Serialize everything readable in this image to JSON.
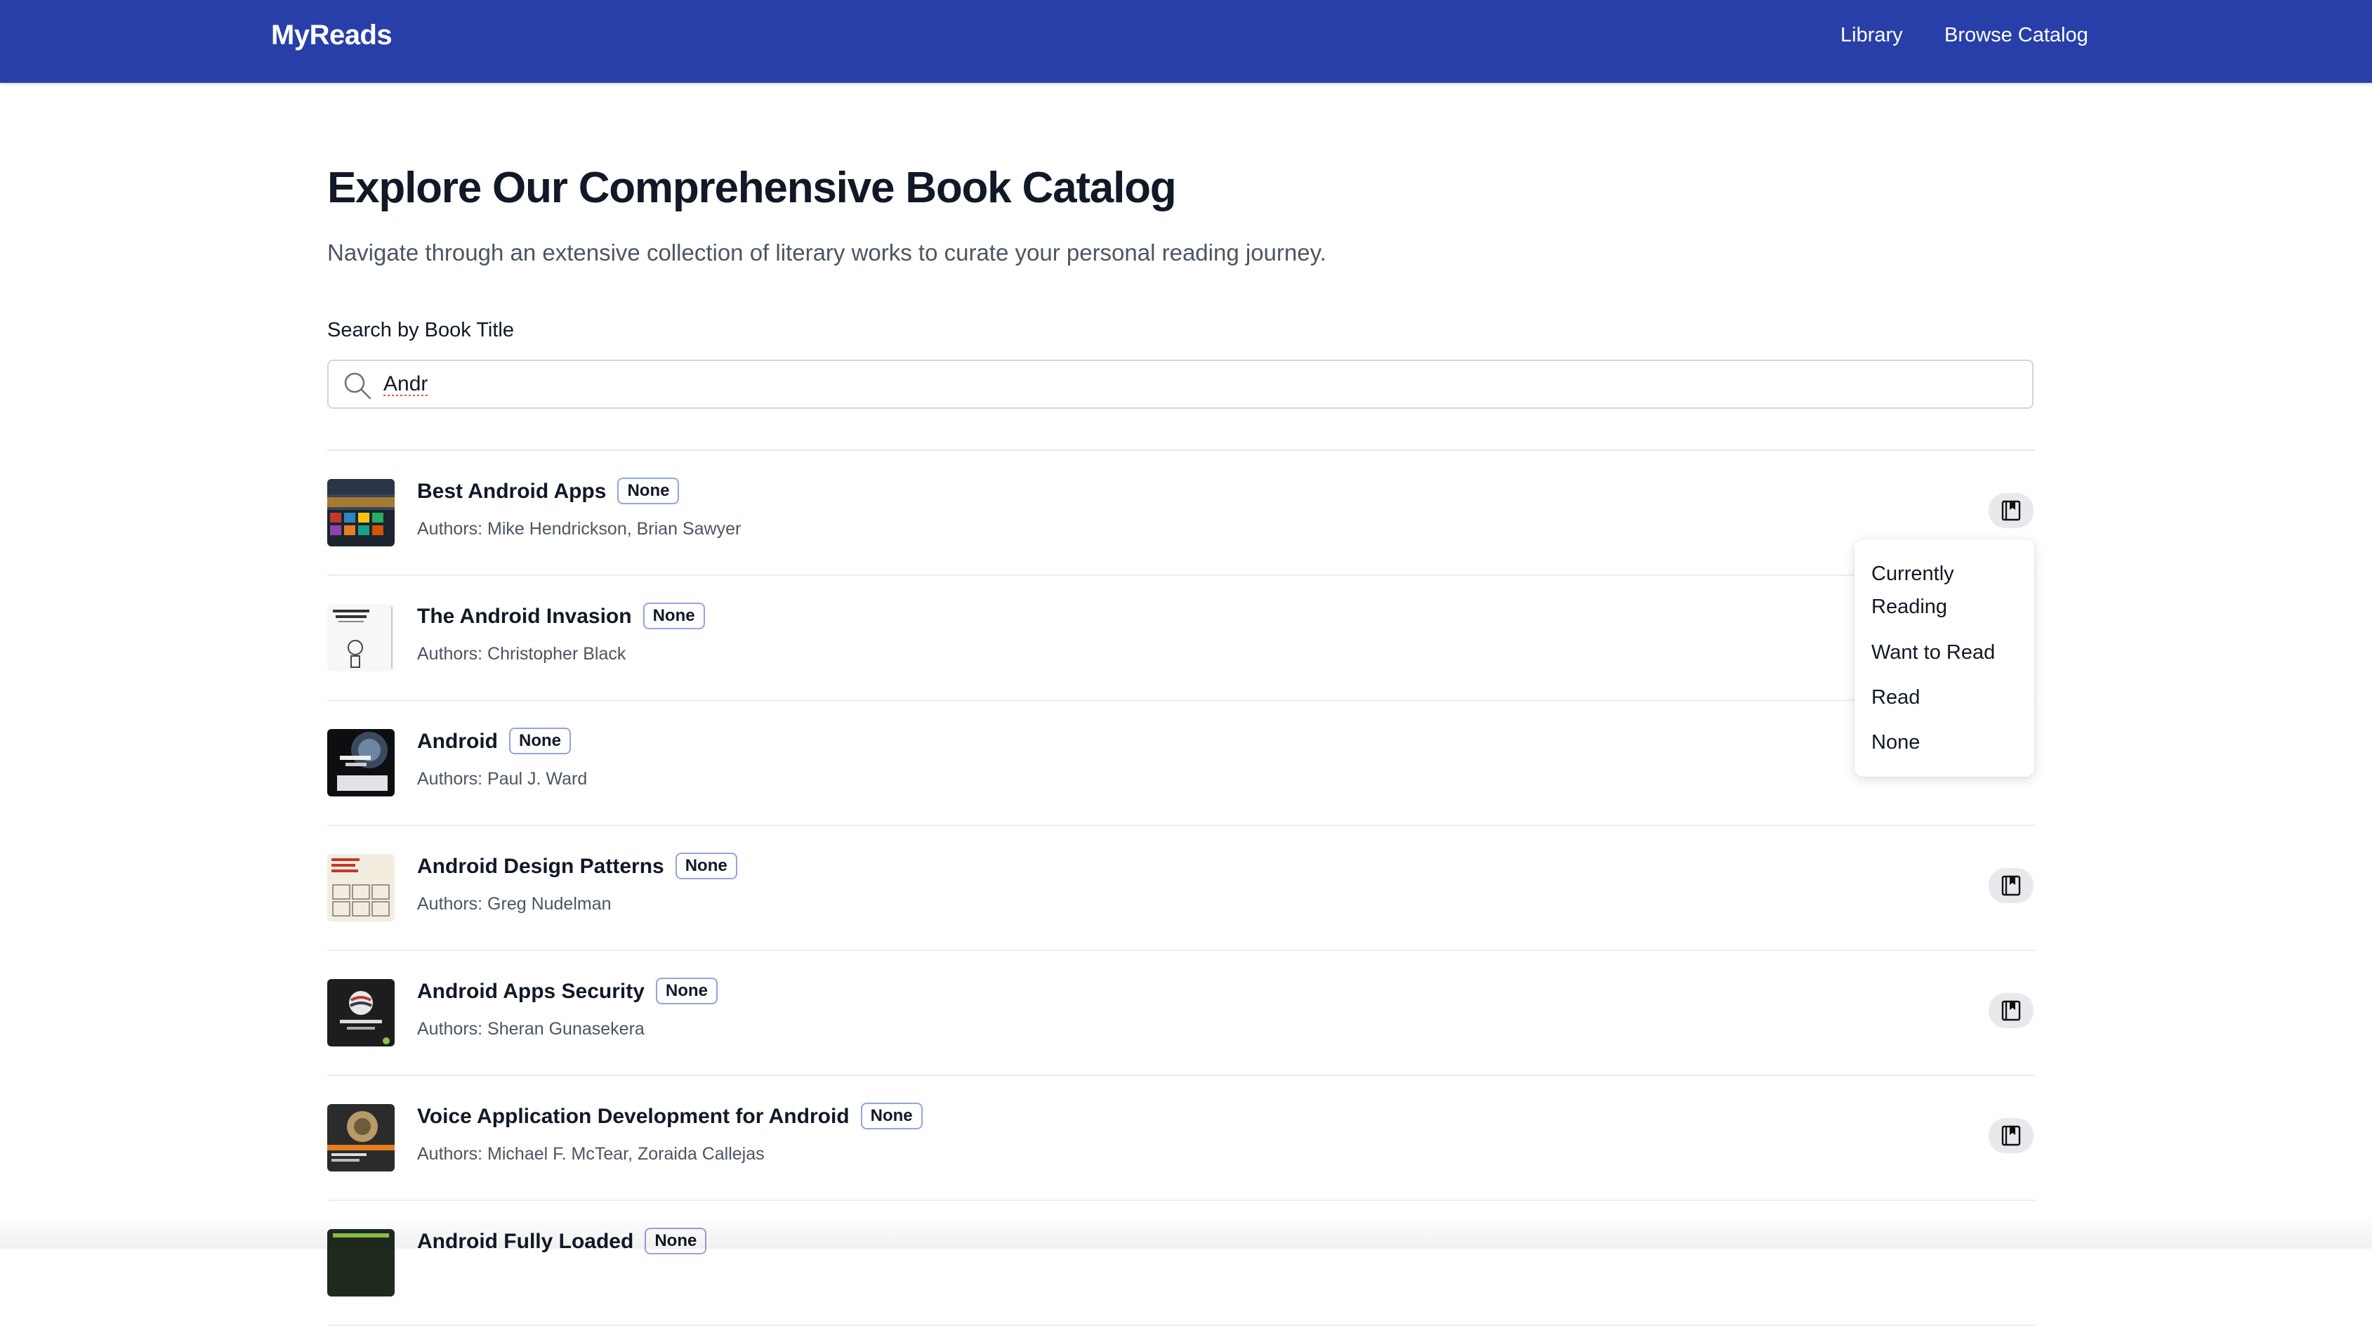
{
  "navbar": {
    "brand": "MyReads",
    "links": [
      {
        "label": "Library"
      },
      {
        "label": "Browse Catalog"
      }
    ]
  },
  "header": {
    "title": "Explore Our Comprehensive Book Catalog",
    "subtitle": "Navigate through an extensive collection of literary works to curate your personal reading journey."
  },
  "search": {
    "label": "Search by Book Title",
    "value": "Andr",
    "icon": "search-icon"
  },
  "books": [
    {
      "title": "Best Android Apps",
      "shelf": "None",
      "authors": "Authors: Mike Hendrickson, Brian Sawyer"
    },
    {
      "title": "The Android Invasion",
      "shelf": "None",
      "authors": "Authors: Christopher Black"
    },
    {
      "title": "Android",
      "shelf": "None",
      "authors": "Authors: Paul J. Ward"
    },
    {
      "title": "Android Design Patterns",
      "shelf": "None",
      "authors": "Authors: Greg Nudelman"
    },
    {
      "title": "Android Apps Security",
      "shelf": "None",
      "authors": "Authors: Sheran Gunasekera"
    },
    {
      "title": "Voice Application Development for Android",
      "shelf": "None",
      "authors": "Authors: Michael F. McTear, Zoraida Callejas"
    },
    {
      "title": "Android Fully Loaded",
      "shelf": "None",
      "authors": ""
    }
  ],
  "shelf_menu": {
    "open_for_book": 0,
    "options": [
      "Currently Reading",
      "Want to Read",
      "Read",
      "None"
    ]
  },
  "colors": {
    "navbar": "#283fa9",
    "badge_border": "#93a4df",
    "shelf_button_bg": "#e8e9ec"
  }
}
